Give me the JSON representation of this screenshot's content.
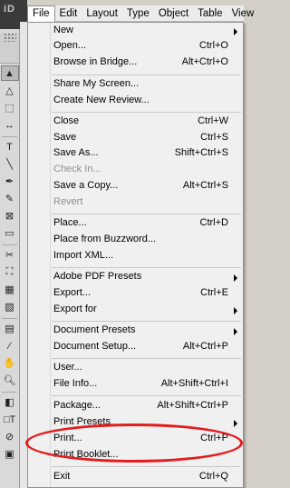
{
  "app": {
    "logo": "iD"
  },
  "menubar": {
    "items": [
      "File",
      "Edit",
      "Layout",
      "Type",
      "Object",
      "Table",
      "View"
    ]
  },
  "file_menu": {
    "items": [
      {
        "label": "New",
        "shortcut": "",
        "submenu": true
      },
      {
        "label": "Open...",
        "shortcut": "Ctrl+O"
      },
      {
        "label": "Browse in Bridge...",
        "shortcut": "Alt+Ctrl+O"
      },
      {
        "label": "Share My Screen...",
        "shortcut": ""
      },
      {
        "label": "Create New Review...",
        "shortcut": ""
      },
      {
        "label": "Close",
        "shortcut": "Ctrl+W"
      },
      {
        "label": "Save",
        "shortcut": "Ctrl+S"
      },
      {
        "label": "Save As...",
        "shortcut": "Shift+Ctrl+S"
      },
      {
        "label": "Check In...",
        "shortcut": "",
        "disabled": true
      },
      {
        "label": "Save a Copy...",
        "shortcut": "Alt+Ctrl+S"
      },
      {
        "label": "Revert",
        "shortcut": "",
        "disabled": true
      },
      {
        "label": "Place...",
        "shortcut": "Ctrl+D"
      },
      {
        "label": "Place from Buzzword...",
        "shortcut": ""
      },
      {
        "label": "Import XML...",
        "shortcut": ""
      },
      {
        "label": "Adobe PDF Presets",
        "shortcut": "",
        "submenu": true
      },
      {
        "label": "Export...",
        "shortcut": "Ctrl+E"
      },
      {
        "label": "Export for",
        "shortcut": "",
        "submenu": true
      },
      {
        "label": "Document Presets",
        "shortcut": "",
        "submenu": true
      },
      {
        "label": "Document Setup...",
        "shortcut": "Alt+Ctrl+P"
      },
      {
        "label": "User...",
        "shortcut": ""
      },
      {
        "label": "File Info...",
        "shortcut": "Alt+Shift+Ctrl+I"
      },
      {
        "label": "Package...",
        "shortcut": "Alt+Shift+Ctrl+P"
      },
      {
        "label": "Print Presets",
        "shortcut": "",
        "submenu": true
      },
      {
        "label": "Print...",
        "shortcut": "Ctrl+P"
      },
      {
        "label": "Print Booklet...",
        "shortcut": ""
      },
      {
        "label": "Exit",
        "shortcut": "Ctrl+Q"
      }
    ]
  },
  "colors": {
    "highlight": "#e51b1b",
    "menu_bg": "#f0f0f0"
  }
}
